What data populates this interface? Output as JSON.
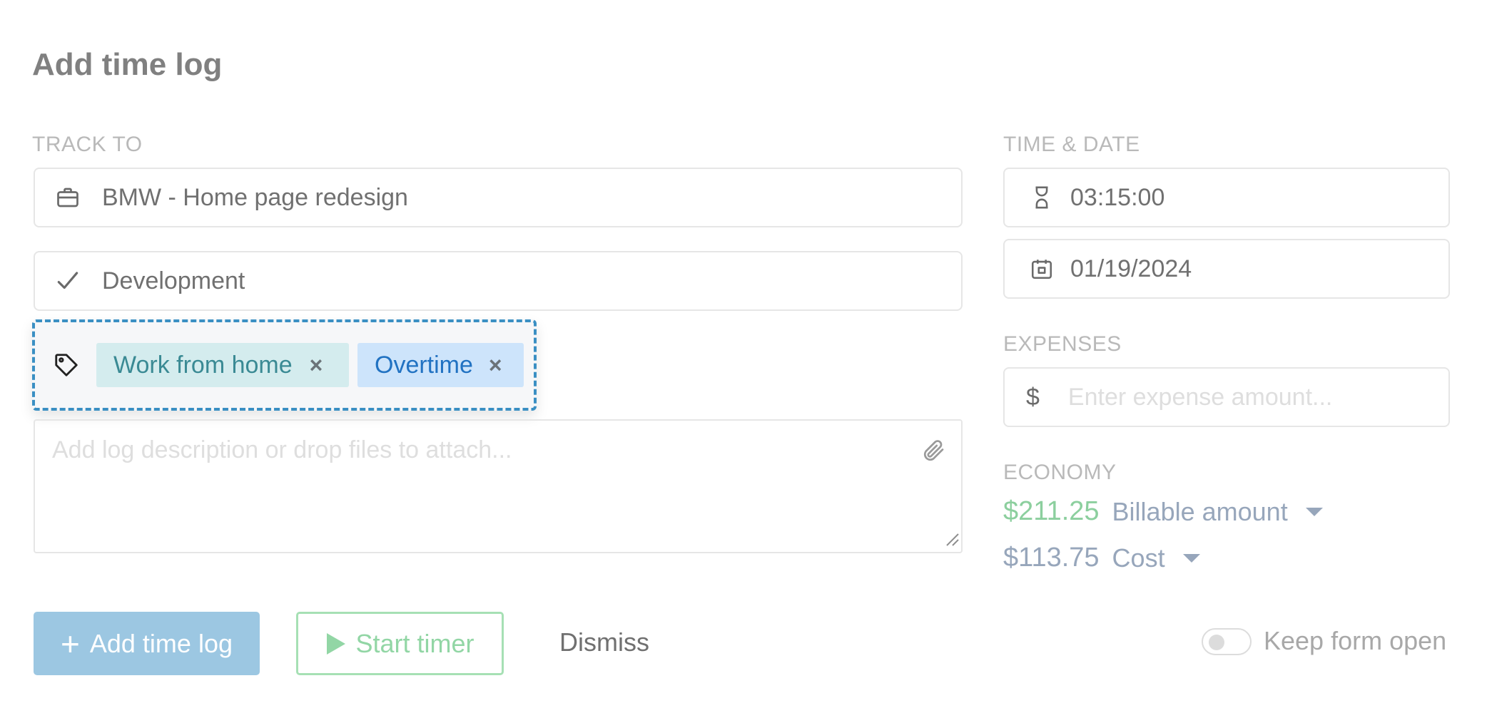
{
  "title": "Add time log",
  "track_to": {
    "label": "TRACK TO",
    "project": "BMW - Home page redesign",
    "task": "Development",
    "tags": [
      {
        "label": "Work from home",
        "remove": "×"
      },
      {
        "label": "Overtime",
        "remove": "×"
      }
    ],
    "description_placeholder": "Add log description or drop files to attach..."
  },
  "time_date": {
    "label": "TIME & DATE",
    "duration": "03:15:00",
    "date": "01/19/2024"
  },
  "expenses": {
    "label": "EXPENSES",
    "currency_symbol": "$",
    "placeholder": "Enter expense amount..."
  },
  "economy": {
    "label": "ECONOMY",
    "billable_value": "$211.25",
    "billable_label": "Billable amount",
    "cost_value": "$113.75",
    "cost_label": "Cost"
  },
  "actions": {
    "add_label": "Add time log",
    "add_icon": "+",
    "start_timer_label": "Start timer",
    "dismiss_label": "Dismiss",
    "keep_open_label": "Keep form open"
  },
  "colors": {
    "billable": "#8ccf9e",
    "cost": "#97a6bb",
    "tag_outline": "#3a8fc3",
    "primary_button": "#9cc7e2"
  }
}
